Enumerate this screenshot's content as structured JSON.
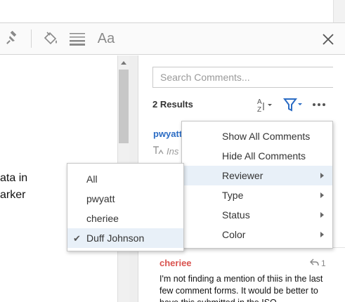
{
  "toolbar": {
    "pin_icon": "pin-icon",
    "fill_icon": "paint-bucket-icon",
    "lines_icon": "line-weight-icon",
    "text_style_label": "Aa",
    "close_icon": "close-icon"
  },
  "document": {
    "lines": [
      "ata in",
      "arker"
    ]
  },
  "comments": {
    "search_placeholder": "Search Comments...",
    "results_label": "2 Results",
    "sort_icon": "sort-az-icon",
    "filter_icon": "filter-icon",
    "more_icon": "more-options-icon",
    "items": [
      {
        "author": "pwyatt",
        "subtext": "Ins",
        "icon": "insert-text-icon"
      },
      {
        "author": "cheriee",
        "reply_count": "1",
        "reply_icon": "reply-icon",
        "body": "I'm not finding a mention of thiis in the last few comment forms. It would be better to have this submitted in the ISO"
      }
    ]
  },
  "filter_menu": {
    "items": [
      {
        "label": "Show All Comments",
        "has_submenu": false
      },
      {
        "label": "Hide All Comments",
        "has_submenu": false
      },
      {
        "label": "Reviewer",
        "has_submenu": true,
        "highlighted": true
      },
      {
        "label": "Type",
        "has_submenu": true
      },
      {
        "label": "Status",
        "has_submenu": true
      },
      {
        "label": "Color",
        "has_submenu": true
      }
    ]
  },
  "reviewer_submenu": {
    "items": [
      {
        "label": "All",
        "checked": false
      },
      {
        "label": "pwyatt",
        "checked": false
      },
      {
        "label": "cheriee",
        "checked": false
      },
      {
        "label": "Duff Johnson",
        "checked": true,
        "highlighted": true
      }
    ]
  },
  "colors": {
    "accent_blue": "#2b6cc4",
    "author2_red": "#d9534f",
    "menu_highlight": "#e8f0f8"
  }
}
